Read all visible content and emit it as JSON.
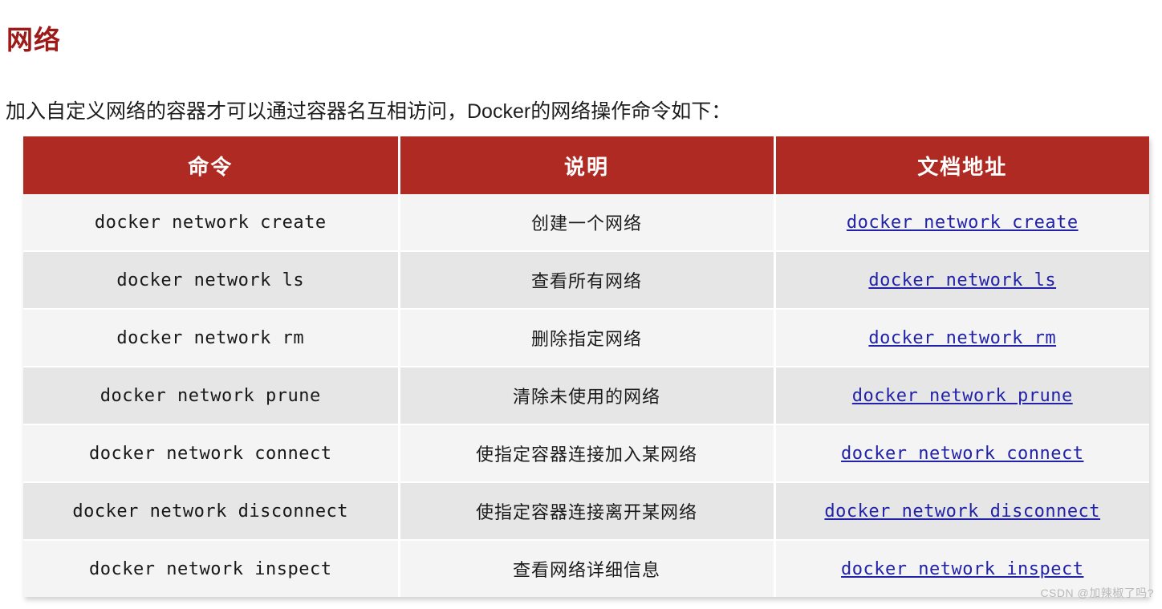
{
  "heading": {
    "title": "网络"
  },
  "intro": {
    "text": "加入自定义网络的容器才可以通过容器名互相访问，Docker的网络操作命令如下："
  },
  "colors": {
    "title_red": "#9c1a17",
    "header_red": "#af2a22",
    "link_blue": "#2222a8",
    "row_odd_bg": "#f4f4f4",
    "row_even_bg": "#e6e6e6",
    "watermark_gray": "#b9b9b9"
  },
  "table": {
    "headers": [
      "命令",
      "说明",
      "文档地址"
    ],
    "rows": [
      {
        "command": "docker network create",
        "description": "创建一个网络",
        "doc": "docker network create"
      },
      {
        "command": "docker network ls",
        "description": "查看所有网络",
        "doc": "docker network ls"
      },
      {
        "command": "docker network rm",
        "description": "删除指定网络",
        "doc": "docker network rm"
      },
      {
        "command": "docker network prune",
        "description": "清除未使用的网络",
        "doc": "docker network prune"
      },
      {
        "command": "docker network connect",
        "description": "使指定容器连接加入某网络",
        "doc": "docker network connect"
      },
      {
        "command": "docker network disconnect",
        "description": "使指定容器连接离开某网络",
        "doc": "docker network disconnect"
      },
      {
        "command": "docker network inspect",
        "description": "查看网络详细信息",
        "doc": "docker network inspect"
      }
    ]
  },
  "watermark": {
    "text": "CSDN @加辣椒了吗?"
  }
}
